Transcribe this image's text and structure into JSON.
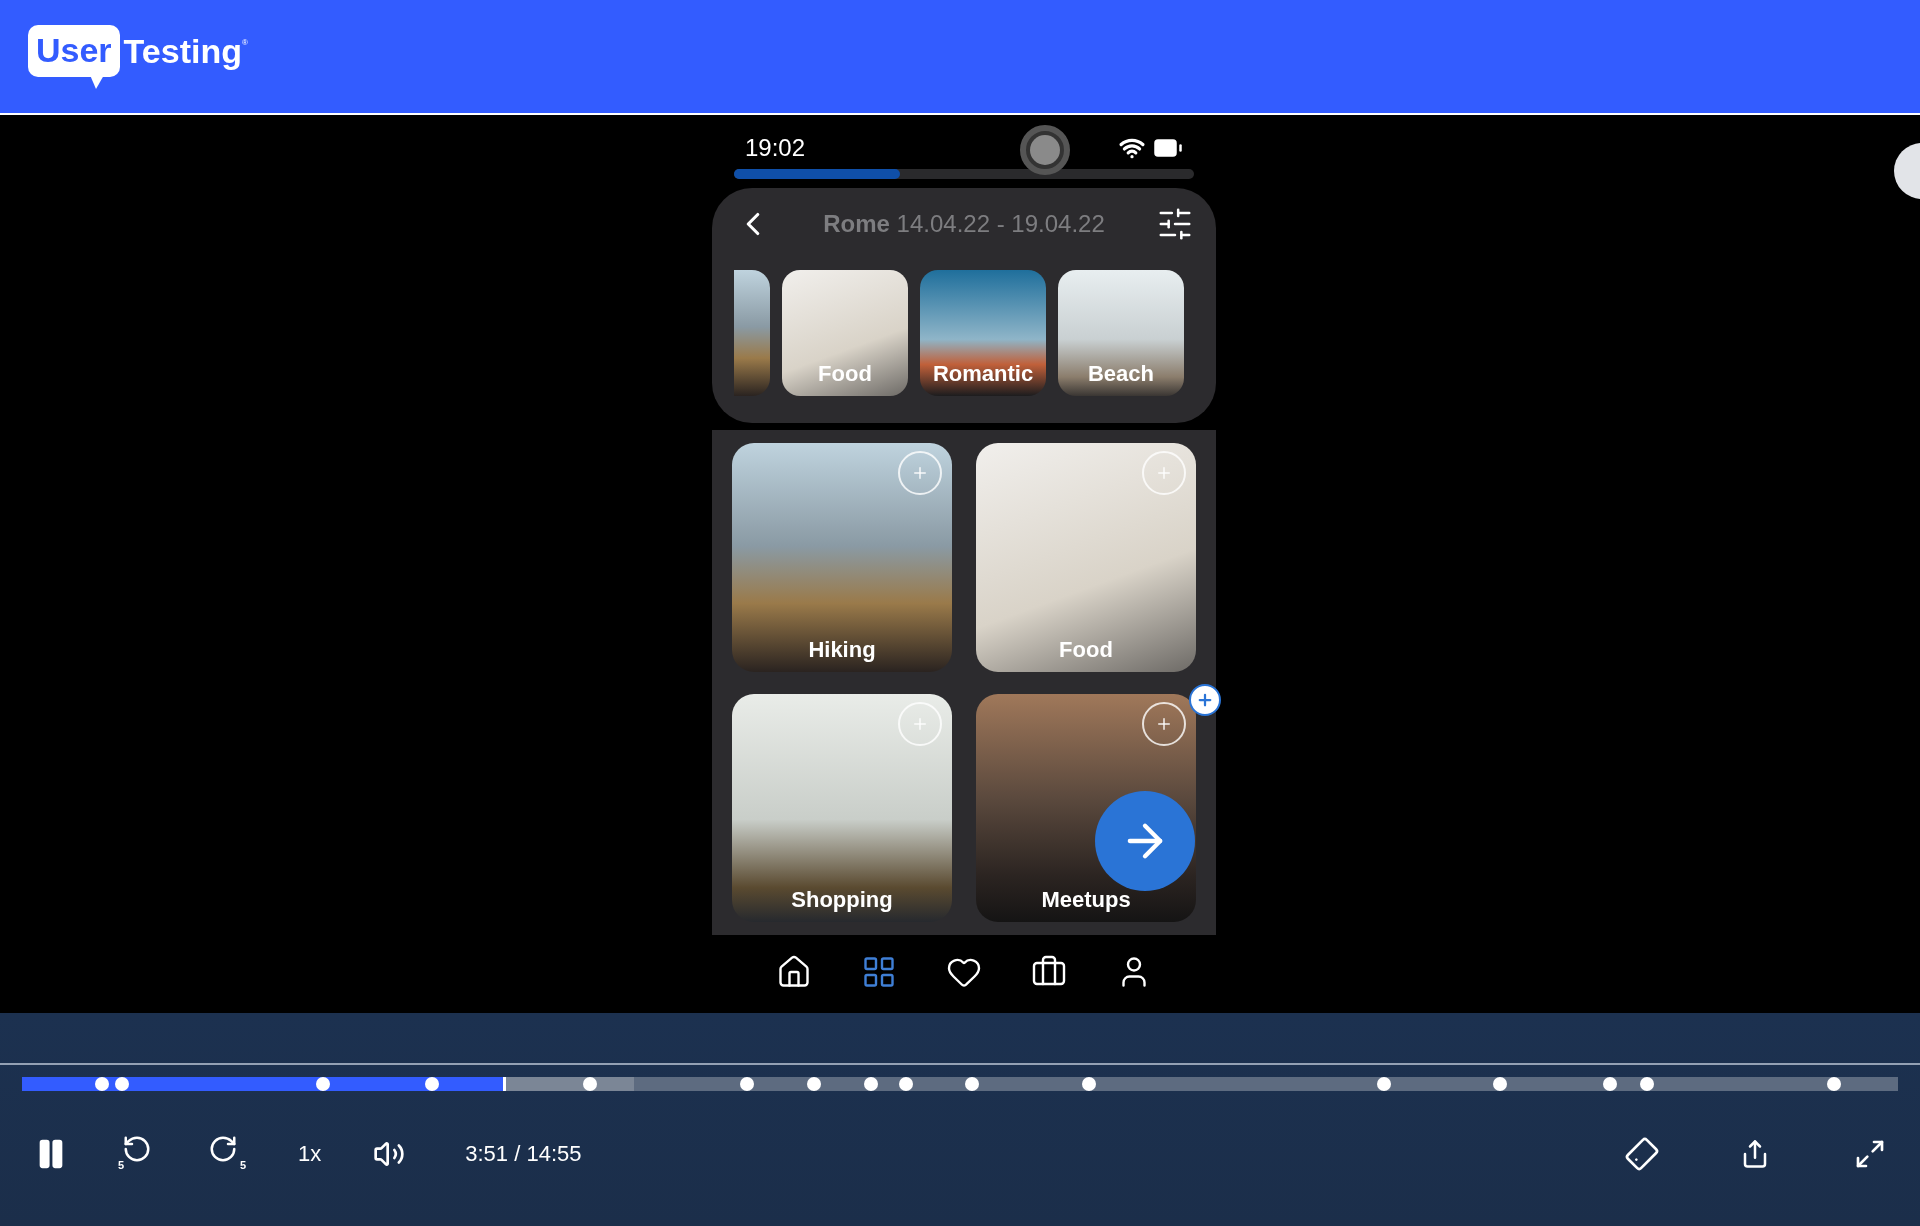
{
  "header": {
    "logo_box": "User",
    "logo_text": "Testing",
    "logo_mark": "®"
  },
  "phone": {
    "time": "19:02",
    "progress": {
      "level": 0.36
    },
    "trip": {
      "city": "Rome",
      "dates": "14.04.22 - 19.04.22"
    },
    "categories": [
      {
        "label": "Food",
        "kind": "food"
      },
      {
        "label": "Romantic",
        "kind": "sunset"
      },
      {
        "label": "Beach",
        "kind": "beach"
      }
    ],
    "cards": [
      {
        "label": "Hiking",
        "kind": "mountain"
      },
      {
        "label": "Food",
        "kind": "food"
      },
      {
        "label": "Shopping",
        "kind": "store"
      },
      {
        "label": "Meetups",
        "kind": "street"
      }
    ],
    "nav": [
      {
        "kind": "home",
        "selected": false
      },
      {
        "kind": "grid",
        "selected": true
      },
      {
        "kind": "heart",
        "selected": false
      },
      {
        "kind": "suitcase",
        "selected": false
      },
      {
        "kind": "person",
        "selected": false
      }
    ]
  },
  "player": {
    "progress": {
      "level": 0.258
    },
    "buffer": {
      "level": 0.326
    },
    "playing": true,
    "skip_back": "5",
    "skip_forward": "5",
    "speed": "1x",
    "time": "3:51 / 14:55"
  }
}
